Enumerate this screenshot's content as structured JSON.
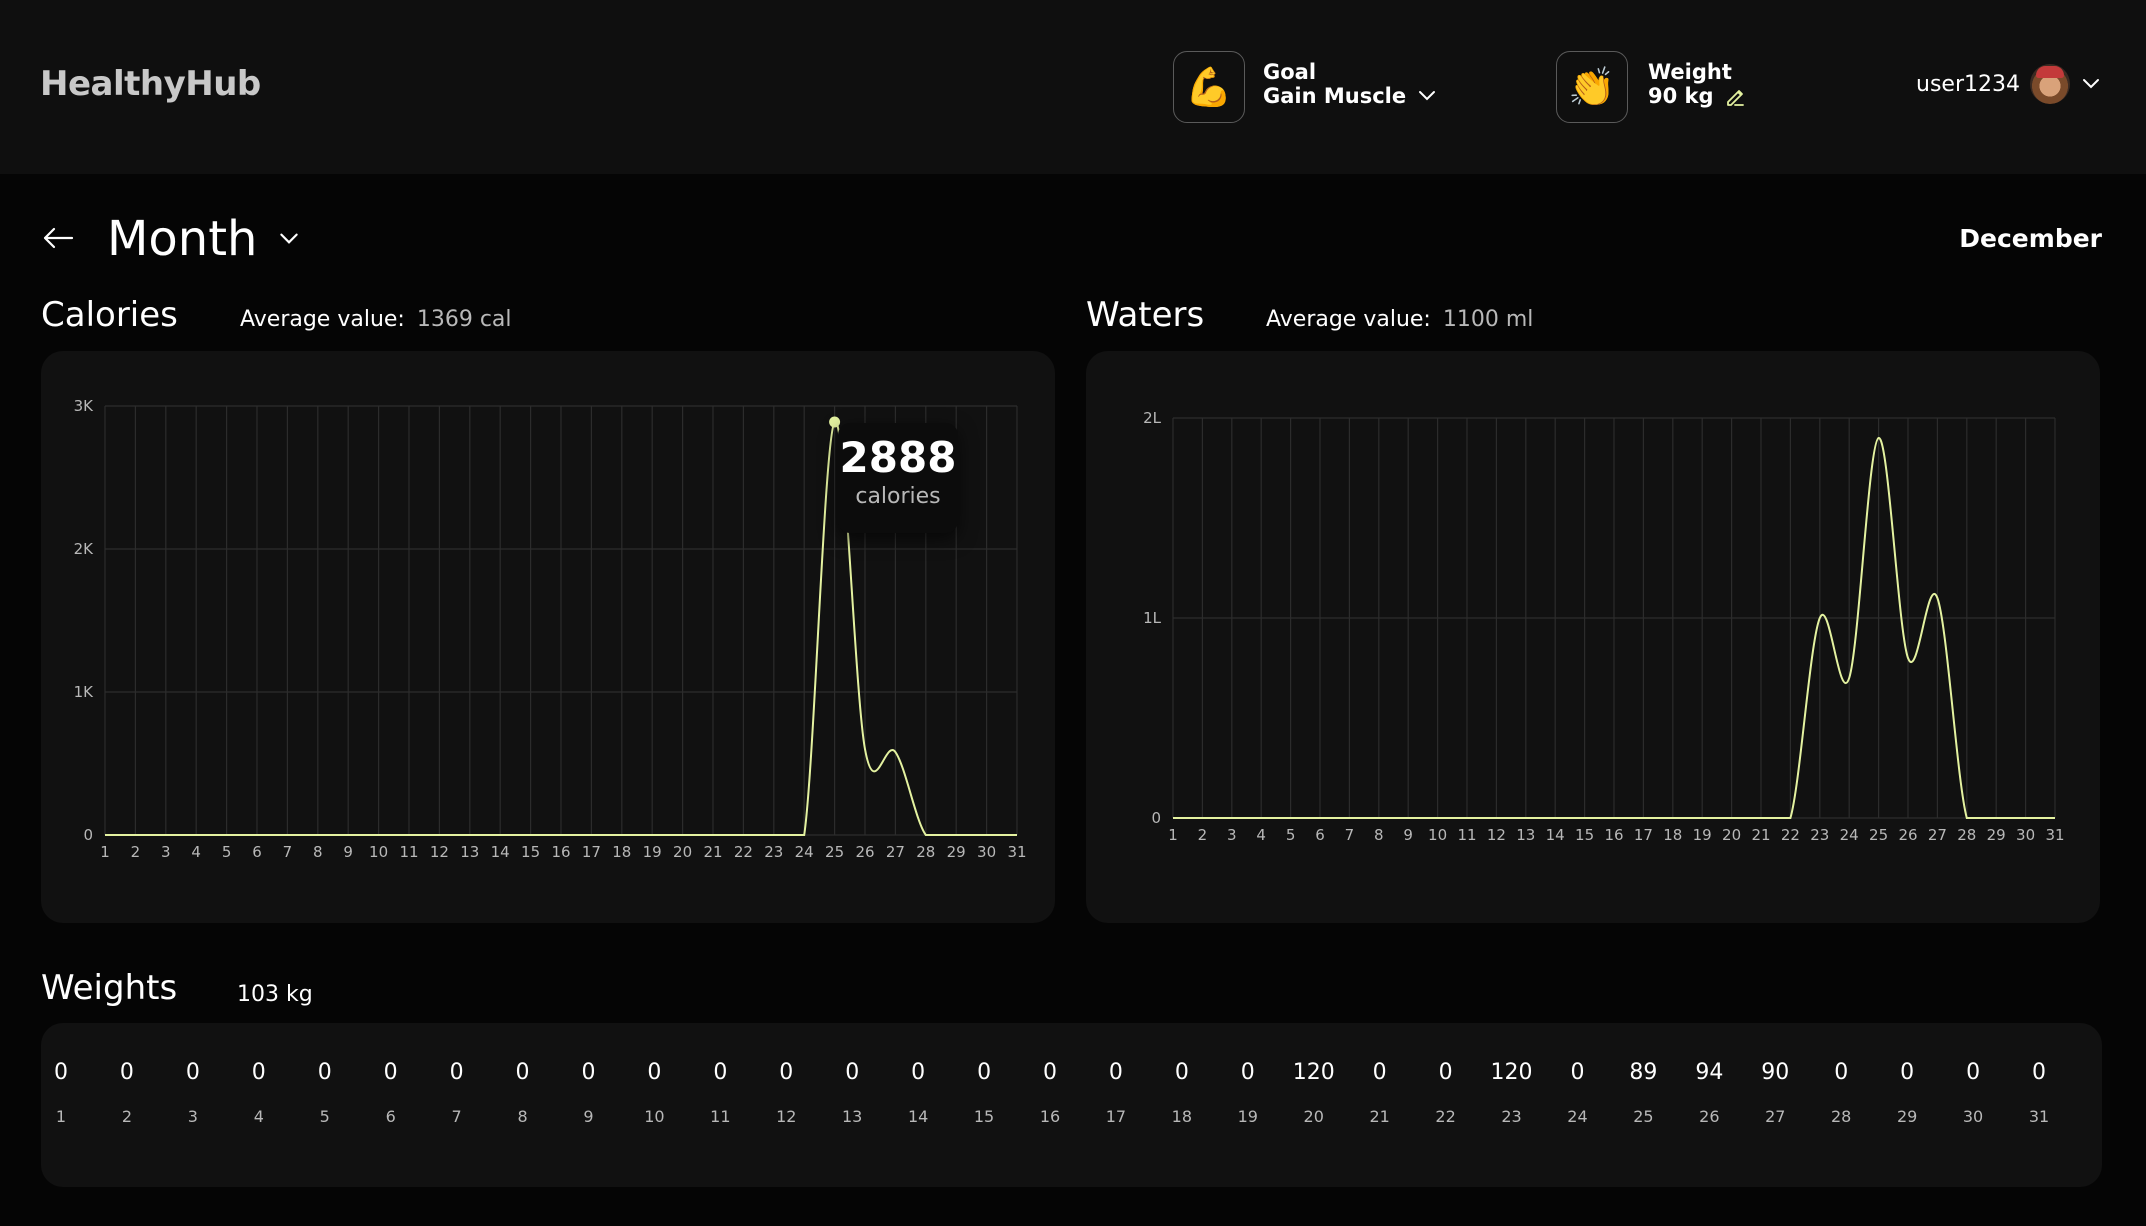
{
  "app": {
    "title": "HealthyHub"
  },
  "header": {
    "goal": {
      "icon": "flexed-biceps-icon",
      "title": "Goal",
      "value": "Gain Muscle"
    },
    "weight": {
      "icon": "clapping-hands-icon",
      "title": "Weight",
      "value": "90 kg"
    },
    "user": {
      "name": "user1234"
    }
  },
  "period": {
    "label": "Month",
    "month": "December"
  },
  "calories": {
    "title": "Calories",
    "avg_label": "Average value:",
    "avg_value": "1369 cal",
    "tooltip": {
      "value": "2888",
      "unit": "calories"
    }
  },
  "waters": {
    "title": "Waters",
    "avg_label": "Average value:",
    "avg_value": "1100 ml"
  },
  "weights": {
    "title": "Weights",
    "summary": "103 kg",
    "values": [
      "0",
      "0",
      "0",
      "0",
      "0",
      "0",
      "0",
      "0",
      "0",
      "0",
      "0",
      "0",
      "0",
      "0",
      "0",
      "0",
      "0",
      "0",
      "0",
      "120",
      "0",
      "0",
      "120",
      "0",
      "89",
      "94",
      "90",
      "0",
      "0",
      "0",
      "0"
    ],
    "days": [
      "1",
      "2",
      "3",
      "4",
      "5",
      "6",
      "7",
      "8",
      "9",
      "10",
      "11",
      "12",
      "13",
      "14",
      "15",
      "16",
      "17",
      "18",
      "19",
      "20",
      "21",
      "22",
      "23",
      "24",
      "25",
      "26",
      "27",
      "28",
      "29",
      "30",
      "31"
    ]
  },
  "colors": {
    "line": "#e4f2a0",
    "grid": "#2c2c2c",
    "card": "#111111",
    "header": "#0f0f0f"
  },
  "chart_data": [
    {
      "type": "line",
      "name": "calories",
      "x": [
        1,
        2,
        3,
        4,
        5,
        6,
        7,
        8,
        9,
        10,
        11,
        12,
        13,
        14,
        15,
        16,
        17,
        18,
        19,
        20,
        21,
        22,
        23,
        24,
        25,
        26,
        27,
        28,
        29,
        30,
        31
      ],
      "y": [
        0,
        0,
        0,
        0,
        0,
        0,
        0,
        0,
        0,
        0,
        0,
        0,
        0,
        0,
        0,
        0,
        0,
        0,
        0,
        0,
        0,
        0,
        0,
        0,
        2888,
        600,
        580,
        0,
        0,
        0,
        0
      ],
      "yticks": [
        "0",
        "1K",
        "2K",
        "3K"
      ],
      "ylim": [
        0,
        3000
      ],
      "grid": true,
      "highlight_point": {
        "x": 25,
        "y": 2888
      }
    },
    {
      "type": "line",
      "name": "waters",
      "x": [
        1,
        2,
        3,
        4,
        5,
        6,
        7,
        8,
        9,
        10,
        11,
        12,
        13,
        14,
        15,
        16,
        17,
        18,
        19,
        20,
        21,
        22,
        23,
        24,
        25,
        26,
        27,
        28,
        29,
        30,
        31
      ],
      "y": [
        0,
        0,
        0,
        0,
        0,
        0,
        0,
        0,
        0,
        0,
        0,
        0,
        0,
        0,
        0,
        0,
        0,
        0,
        0,
        0,
        0,
        0,
        1000,
        700,
        1900,
        800,
        1100,
        0,
        0,
        0,
        0
      ],
      "yticks": [
        "0",
        "1L",
        "2L"
      ],
      "ylim": [
        0,
        2000
      ],
      "grid": true
    }
  ]
}
